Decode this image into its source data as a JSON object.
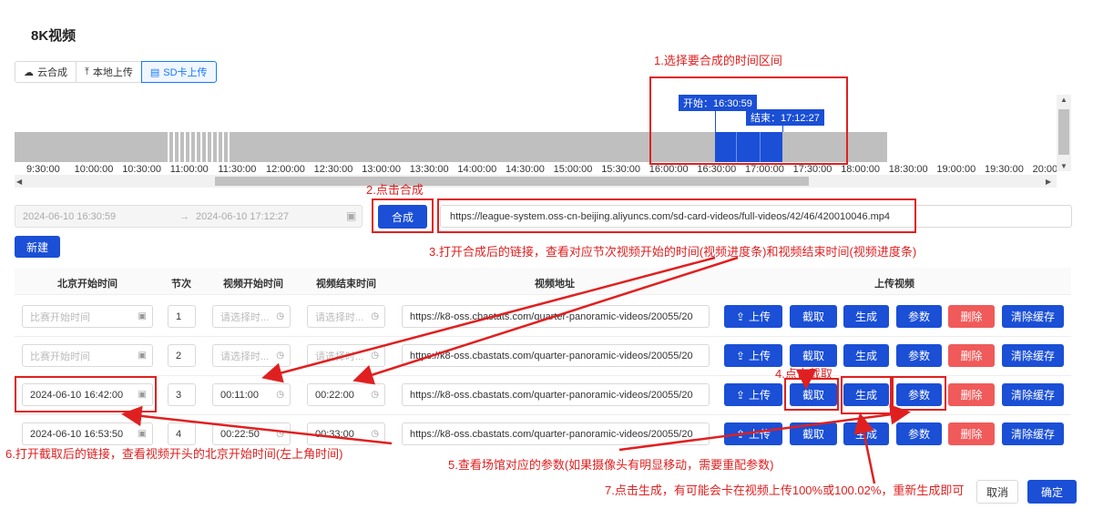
{
  "page_title": "8K视频",
  "modes": [
    {
      "label": "云合成",
      "icon": "cloud-icon"
    },
    {
      "label": "本地上传",
      "icon": "upload-icon"
    },
    {
      "label": "SD卡上传",
      "icon": "file-icon",
      "active": true
    }
  ],
  "timeline": {
    "start_tag": "开始：16:30:59",
    "end_tag": "结束：17:12:27",
    "ticks": [
      "9:30:00",
      "10:00:00",
      "10:30:00",
      "11:00:00",
      "11:30:00",
      "12:00:00",
      "12:30:00",
      "13:00:00",
      "13:30:00",
      "14:00:00",
      "14:30:00",
      "15:00:00",
      "15:30:00",
      "16:00:00",
      "16:30:00",
      "17:00:00",
      "17:30:00",
      "18:00:00",
      "18:30:00",
      "19:00:00",
      "19:30:00",
      "20:00"
    ]
  },
  "range": {
    "start": "2024-06-10 16:30:59",
    "end": "2024-06-10 17:12:27",
    "sep": "→"
  },
  "compose_button": "合成",
  "compose_url": "https://league-system.oss-cn-beijing.aliyuncs.com/sd-card-videos/full-videos/42/46/420010046.mp4",
  "new_button": "新建",
  "columns": [
    "北京开始时间",
    "节次",
    "视频开始时间",
    "视频结束时间",
    "视频地址",
    "上传视频"
  ],
  "rows": [
    {
      "beijing": "比赛开始时间",
      "beijing_ph": true,
      "period": "1",
      "vstart": "请选择时...",
      "vstart_ph": true,
      "vend": "请选择时...",
      "vend_ph": true,
      "url": "https://k8-oss.cbastats.com/quarter-panoramic-videos/20055/20"
    },
    {
      "beijing": "比赛开始时间",
      "beijing_ph": true,
      "period": "2",
      "vstart": "请选择时...",
      "vstart_ph": true,
      "vend": "请选择时...",
      "vend_ph": true,
      "url": "https://k8-oss.cbastats.com/quarter-panoramic-videos/20055/20"
    },
    {
      "beijing": "2024-06-10 16:42:00",
      "period": "3",
      "vstart": "00:11:00",
      "vend": "00:22:00",
      "url": "https://k8-oss.cbastats.com/quarter-panoramic-videos/20055/20"
    },
    {
      "beijing": "2024-06-10 16:53:50",
      "period": "4",
      "vstart": "00:22:50",
      "vend": "00:33:00",
      "url": "https://k8-oss.cbastats.com/quarter-panoramic-videos/20055/20"
    }
  ],
  "row_actions": {
    "upload": "上传",
    "clip": "截取",
    "generate": "生成",
    "params": "参数",
    "delete": "删除",
    "clear": "清除缓存"
  },
  "footer": {
    "cancel": "取消",
    "confirm": "确定"
  },
  "annotations": {
    "a1": "1.选择要合成的时间区间",
    "a2": "2.点击合成",
    "a3": "3.打开合成后的链接，查看对应节次视频开始的时间(视频进度条)和视频结束时间(视频进度条)",
    "a4": "4.点击截取",
    "a5": "5.查看场馆对应的参数(如果摄像头有明显移动，需要重配参数)",
    "a6": "6.打开截取后的链接，查看视频开头的北京开始时间(左上角时间)",
    "a7": "7.点击生成，有可能会卡在视频上传100%或100.02%，重新生成即可"
  },
  "colors": {
    "primary": "#1a4fd6",
    "danger": "#f05a5a",
    "annotation": "#e02020"
  }
}
